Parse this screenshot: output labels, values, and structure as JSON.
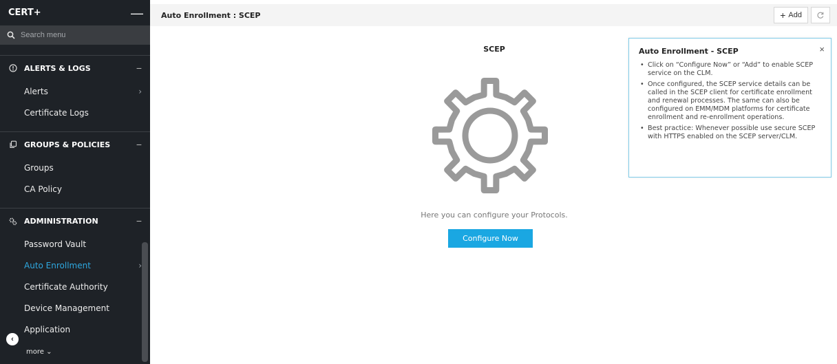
{
  "sidebar": {
    "brand": "CERT+",
    "collapse_glyph": "—",
    "search_placeholder": "Search menu",
    "sections": [
      {
        "title": "ALERTS & LOGS",
        "icon": "alert-circle-icon",
        "items": [
          {
            "label": "Alerts",
            "has_chevron": true,
            "active": false
          },
          {
            "label": "Certificate Logs",
            "has_chevron": false,
            "active": false
          }
        ]
      },
      {
        "title": "GROUPS & POLICIES",
        "icon": "copy-icon",
        "items": [
          {
            "label": "Groups",
            "has_chevron": false,
            "active": false
          },
          {
            "label": "CA Policy",
            "has_chevron": false,
            "active": false
          }
        ]
      },
      {
        "title": "ADMINISTRATION",
        "icon": "cogs-icon",
        "items": [
          {
            "label": "Password Vault",
            "has_chevron": false,
            "active": false
          },
          {
            "label": "Auto Enrollment",
            "has_chevron": true,
            "active": true
          },
          {
            "label": "Certificate Authority",
            "has_chevron": false,
            "active": false
          },
          {
            "label": "Device Management",
            "has_chevron": false,
            "active": false
          },
          {
            "label": "Application",
            "has_chevron": false,
            "active": false
          }
        ]
      }
    ],
    "more_label": "more ⌄",
    "accent_color": "#2ea8e0"
  },
  "header": {
    "title": "Auto Enrollment : SCEP",
    "add_label": "Add"
  },
  "main": {
    "title": "SCEP",
    "empty_state_text": "Here you can configure your Protocols.",
    "configure_label": "Configure Now",
    "configure_color": "#1aa7e2"
  },
  "help_panel": {
    "title": "Auto Enrollment - SCEP",
    "bullets": [
      "Click on “Configure Now” or “Add” to enable SCEP service on the CLM.",
      "Once configured, the SCEP service details can be called in the SCEP client for certificate enrollment and renewal processes. The same can also be configured on EMM/MDM platforms for certificate enrollment and re-enrollment operations.",
      "Best practice: Whenever possible use secure SCEP with HTTPS enabled on the SCEP server/CLM."
    ],
    "border_color": "#7fcbe8"
  }
}
